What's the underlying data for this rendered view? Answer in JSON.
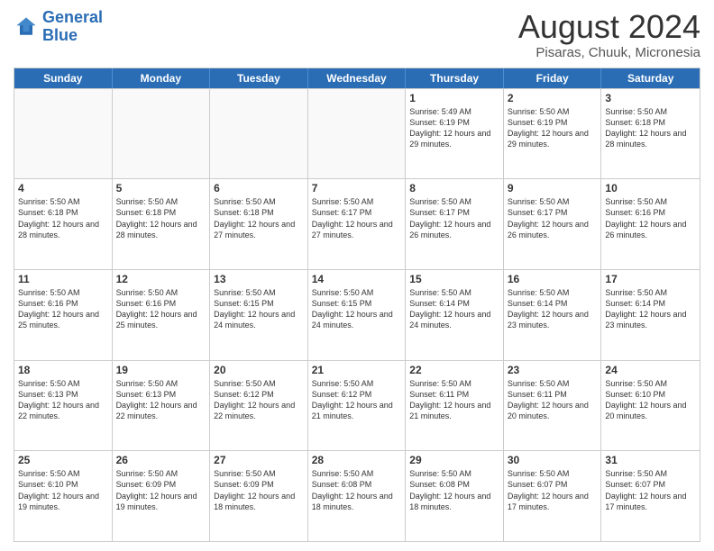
{
  "header": {
    "logo_line1": "General",
    "logo_line2": "Blue",
    "month": "August 2024",
    "location": "Pisaras, Chuuk, Micronesia"
  },
  "weekdays": [
    "Sunday",
    "Monday",
    "Tuesday",
    "Wednesday",
    "Thursday",
    "Friday",
    "Saturday"
  ],
  "rows": [
    [
      {
        "empty": true
      },
      {
        "empty": true
      },
      {
        "empty": true
      },
      {
        "empty": true
      },
      {
        "day": 1,
        "sunrise": "5:49 AM",
        "sunset": "6:19 PM",
        "daylight": "12 hours and 29 minutes."
      },
      {
        "day": 2,
        "sunrise": "5:50 AM",
        "sunset": "6:19 PM",
        "daylight": "12 hours and 29 minutes."
      },
      {
        "day": 3,
        "sunrise": "5:50 AM",
        "sunset": "6:18 PM",
        "daylight": "12 hours and 28 minutes."
      }
    ],
    [
      {
        "day": 4,
        "sunrise": "5:50 AM",
        "sunset": "6:18 PM",
        "daylight": "12 hours and 28 minutes."
      },
      {
        "day": 5,
        "sunrise": "5:50 AM",
        "sunset": "6:18 PM",
        "daylight": "12 hours and 28 minutes."
      },
      {
        "day": 6,
        "sunrise": "5:50 AM",
        "sunset": "6:18 PM",
        "daylight": "12 hours and 27 minutes."
      },
      {
        "day": 7,
        "sunrise": "5:50 AM",
        "sunset": "6:17 PM",
        "daylight": "12 hours and 27 minutes."
      },
      {
        "day": 8,
        "sunrise": "5:50 AM",
        "sunset": "6:17 PM",
        "daylight": "12 hours and 26 minutes."
      },
      {
        "day": 9,
        "sunrise": "5:50 AM",
        "sunset": "6:17 PM",
        "daylight": "12 hours and 26 minutes."
      },
      {
        "day": 10,
        "sunrise": "5:50 AM",
        "sunset": "6:16 PM",
        "daylight": "12 hours and 26 minutes."
      }
    ],
    [
      {
        "day": 11,
        "sunrise": "5:50 AM",
        "sunset": "6:16 PM",
        "daylight": "12 hours and 25 minutes."
      },
      {
        "day": 12,
        "sunrise": "5:50 AM",
        "sunset": "6:16 PM",
        "daylight": "12 hours and 25 minutes."
      },
      {
        "day": 13,
        "sunrise": "5:50 AM",
        "sunset": "6:15 PM",
        "daylight": "12 hours and 24 minutes."
      },
      {
        "day": 14,
        "sunrise": "5:50 AM",
        "sunset": "6:15 PM",
        "daylight": "12 hours and 24 minutes."
      },
      {
        "day": 15,
        "sunrise": "5:50 AM",
        "sunset": "6:14 PM",
        "daylight": "12 hours and 24 minutes."
      },
      {
        "day": 16,
        "sunrise": "5:50 AM",
        "sunset": "6:14 PM",
        "daylight": "12 hours and 23 minutes."
      },
      {
        "day": 17,
        "sunrise": "5:50 AM",
        "sunset": "6:14 PM",
        "daylight": "12 hours and 23 minutes."
      }
    ],
    [
      {
        "day": 18,
        "sunrise": "5:50 AM",
        "sunset": "6:13 PM",
        "daylight": "12 hours and 22 minutes."
      },
      {
        "day": 19,
        "sunrise": "5:50 AM",
        "sunset": "6:13 PM",
        "daylight": "12 hours and 22 minutes."
      },
      {
        "day": 20,
        "sunrise": "5:50 AM",
        "sunset": "6:12 PM",
        "daylight": "12 hours and 22 minutes."
      },
      {
        "day": 21,
        "sunrise": "5:50 AM",
        "sunset": "6:12 PM",
        "daylight": "12 hours and 21 minutes."
      },
      {
        "day": 22,
        "sunrise": "5:50 AM",
        "sunset": "6:11 PM",
        "daylight": "12 hours and 21 minutes."
      },
      {
        "day": 23,
        "sunrise": "5:50 AM",
        "sunset": "6:11 PM",
        "daylight": "12 hours and 20 minutes."
      },
      {
        "day": 24,
        "sunrise": "5:50 AM",
        "sunset": "6:10 PM",
        "daylight": "12 hours and 20 minutes."
      }
    ],
    [
      {
        "day": 25,
        "sunrise": "5:50 AM",
        "sunset": "6:10 PM",
        "daylight": "12 hours and 19 minutes."
      },
      {
        "day": 26,
        "sunrise": "5:50 AM",
        "sunset": "6:09 PM",
        "daylight": "12 hours and 19 minutes."
      },
      {
        "day": 27,
        "sunrise": "5:50 AM",
        "sunset": "6:09 PM",
        "daylight": "12 hours and 18 minutes."
      },
      {
        "day": 28,
        "sunrise": "5:50 AM",
        "sunset": "6:08 PM",
        "daylight": "12 hours and 18 minutes."
      },
      {
        "day": 29,
        "sunrise": "5:50 AM",
        "sunset": "6:08 PM",
        "daylight": "12 hours and 18 minutes."
      },
      {
        "day": 30,
        "sunrise": "5:50 AM",
        "sunset": "6:07 PM",
        "daylight": "12 hours and 17 minutes."
      },
      {
        "day": 31,
        "sunrise": "5:50 AM",
        "sunset": "6:07 PM",
        "daylight": "12 hours and 17 minutes."
      }
    ]
  ]
}
